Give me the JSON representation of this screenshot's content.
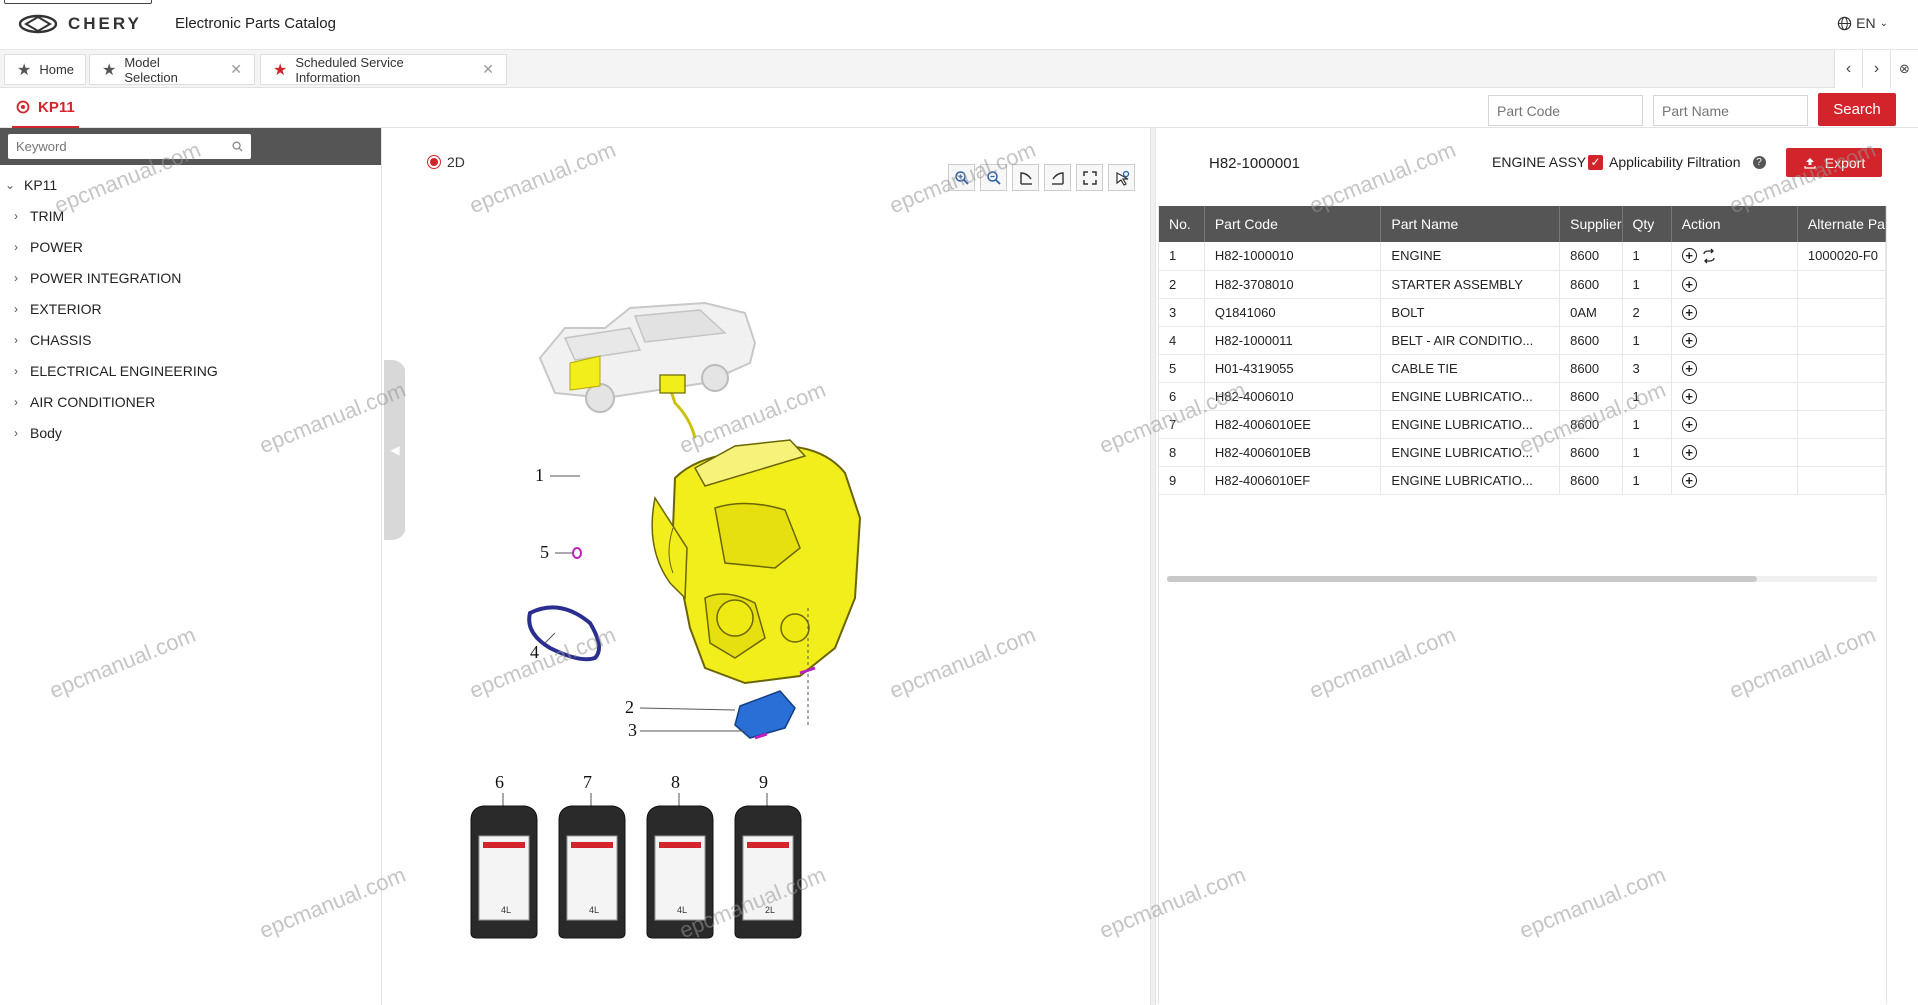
{
  "app": {
    "brand": "CHERY",
    "title": "Electronic Parts Catalog",
    "language": "EN"
  },
  "tabs": [
    {
      "label": "Home",
      "closable": false,
      "active_icon": false
    },
    {
      "label": "Model Selection",
      "closable": true,
      "active_icon": false
    },
    {
      "label": "Scheduled Service Information",
      "closable": true,
      "active_icon": true
    }
  ],
  "model_tab": {
    "label": "KP11"
  },
  "search": {
    "part_code_placeholder": "Part Code",
    "part_name_placeholder": "Part Name",
    "button_label": "Search"
  },
  "sidebar": {
    "keyword_placeholder": "Keyword",
    "root": "KP11",
    "items": [
      "TRIM",
      "POWER",
      "POWER INTEGRATION",
      "EXTERIOR",
      "CHASSIS",
      "ELECTRICAL ENGINEERING",
      "AIR CONDITIONER",
      "Body"
    ]
  },
  "diagram": {
    "view_mode": "2D",
    "callouts": [
      "1",
      "2",
      "3",
      "4",
      "5",
      "6",
      "7",
      "8",
      "9"
    ],
    "oil_sizes": [
      "4L",
      "4L",
      "4L",
      "2L"
    ]
  },
  "parts": {
    "assembly_code": "H82-1000001",
    "assembly_name": "ENGINE ASSY",
    "filter_label": "Applicability Filtration",
    "filter_checked": true,
    "export_label": "Export",
    "columns": [
      "No.",
      "Part Code",
      "Part Name",
      "Supplier",
      "Qty",
      "Action",
      "Alternate Pa"
    ],
    "rows": [
      {
        "no": "1",
        "code": "H82-1000010",
        "name": "ENGINE",
        "supplier": "8600",
        "qty": "1",
        "alt": "1000020-F0"
      },
      {
        "no": "2",
        "code": "H82-3708010",
        "name": "STARTER ASSEMBLY",
        "supplier": "8600",
        "qty": "1",
        "alt": ""
      },
      {
        "no": "3",
        "code": "Q1841060",
        "name": "BOLT",
        "supplier": "0AM",
        "qty": "2",
        "alt": ""
      },
      {
        "no": "4",
        "code": "H82-1000011",
        "name": "BELT - AIR CONDITIO...",
        "supplier": "8600",
        "qty": "1",
        "alt": ""
      },
      {
        "no": "5",
        "code": "H01-4319055",
        "name": "CABLE TIE",
        "supplier": "8600",
        "qty": "3",
        "alt": ""
      },
      {
        "no": "6",
        "code": "H82-4006010",
        "name": "ENGINE LUBRICATIO...",
        "supplier": "8600",
        "qty": "1",
        "alt": ""
      },
      {
        "no": "7",
        "code": "H82-4006010EE",
        "name": "ENGINE LUBRICATIO...",
        "supplier": "8600",
        "qty": "1",
        "alt": ""
      },
      {
        "no": "8",
        "code": "H82-4006010EB",
        "name": "ENGINE LUBRICATIO...",
        "supplier": "8600",
        "qty": "1",
        "alt": ""
      },
      {
        "no": "9",
        "code": "H82-4006010EF",
        "name": "ENGINE LUBRICATIO...",
        "supplier": "8600",
        "qty": "1",
        "alt": ""
      }
    ]
  },
  "watermark": "epcmanual.com",
  "colors": {
    "accent": "#d3242b",
    "header_dark": "#555555",
    "engine": "#f2ee1c",
    "starter": "#2a6fd6",
    "belt": "#2a2f8f"
  }
}
